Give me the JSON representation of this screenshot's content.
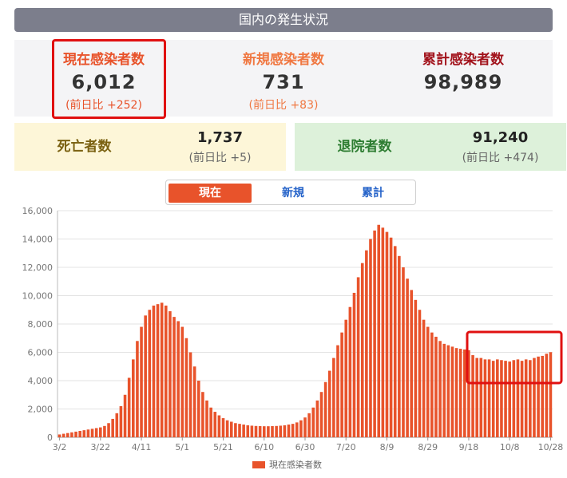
{
  "header": {
    "title": "国内の発生状況"
  },
  "stats": {
    "current": {
      "label": "現在感染者数",
      "value": "6,012",
      "diff": "(前日比 +252)"
    },
    "new": {
      "label": "新規感染者数",
      "value": "731",
      "diff": "(前日比 +83)"
    },
    "total": {
      "label": "累計感染者数",
      "value": "98,989"
    }
  },
  "deaths": {
    "label": "死亡者数",
    "value": "1,737",
    "diff": "(前日比 +5)"
  },
  "discharged": {
    "label": "退院者数",
    "value": "91,240",
    "diff": "(前日比 +474)"
  },
  "tabs": [
    "現在",
    "新規",
    "累計"
  ],
  "colors": {
    "bar": "#e8532b",
    "highlight": "#e01010"
  },
  "chart_data": {
    "type": "bar",
    "title": "",
    "xlabel": "",
    "ylabel": "",
    "ylim": [
      0,
      16000
    ],
    "yticks": [
      "0",
      "2,000",
      "4,000",
      "6,000",
      "8,000",
      "10,000",
      "12,000",
      "14,000",
      "16,000"
    ],
    "xticks": [
      "3/2",
      "3/22",
      "4/11",
      "5/1",
      "5/21",
      "6/10",
      "6/30",
      "7/20",
      "8/9",
      "8/29",
      "9/18",
      "10/8",
      "10/28"
    ],
    "grid": true,
    "legend": {
      "position": "bottom",
      "label": "現在感染者数"
    },
    "series": [
      {
        "name": "現在感染者数",
        "x": [
          "3/2",
          "3/4",
          "3/6",
          "3/8",
          "3/10",
          "3/12",
          "3/14",
          "3/16",
          "3/18",
          "3/20",
          "3/22",
          "3/24",
          "3/26",
          "3/28",
          "3/30",
          "4/1",
          "4/3",
          "4/5",
          "4/7",
          "4/9",
          "4/11",
          "4/13",
          "4/15",
          "4/17",
          "4/19",
          "4/21",
          "4/23",
          "4/25",
          "4/27",
          "4/29",
          "5/1",
          "5/3",
          "5/5",
          "5/7",
          "5/9",
          "5/11",
          "5/13",
          "5/15",
          "5/17",
          "5/19",
          "5/21",
          "5/23",
          "5/25",
          "5/27",
          "5/29",
          "5/31",
          "6/2",
          "6/4",
          "6/6",
          "6/8",
          "6/10",
          "6/12",
          "6/14",
          "6/16",
          "6/18",
          "6/20",
          "6/22",
          "6/24",
          "6/26",
          "6/28",
          "6/30",
          "7/2",
          "7/4",
          "7/6",
          "7/8",
          "7/10",
          "7/12",
          "7/14",
          "7/16",
          "7/18",
          "7/20",
          "7/22",
          "7/24",
          "7/26",
          "7/28",
          "7/30",
          "8/1",
          "8/3",
          "8/5",
          "8/7",
          "8/9",
          "8/11",
          "8/13",
          "8/15",
          "8/17",
          "8/19",
          "8/21",
          "8/23",
          "8/25",
          "8/27",
          "8/29",
          "8/31",
          "9/2",
          "9/4",
          "9/6",
          "9/8",
          "9/10",
          "9/12",
          "9/14",
          "9/16",
          "9/18",
          "9/20",
          "9/22",
          "9/24",
          "9/26",
          "9/28",
          "9/30",
          "10/2",
          "10/4",
          "10/6",
          "10/8",
          "10/10",
          "10/12",
          "10/14",
          "10/16",
          "10/18",
          "10/20",
          "10/22",
          "10/24",
          "10/26",
          "10/28"
        ],
        "values": [
          200,
          250,
          300,
          350,
          400,
          450,
          500,
          550,
          600,
          650,
          700,
          800,
          1000,
          1300,
          1700,
          2200,
          3000,
          4200,
          5500,
          6800,
          7800,
          8600,
          9000,
          9300,
          9400,
          9500,
          9300,
          8900,
          8500,
          8200,
          7800,
          7000,
          6000,
          5000,
          4000,
          3200,
          2600,
          2100,
          1800,
          1550,
          1350,
          1200,
          1100,
          1000,
          950,
          900,
          850,
          820,
          800,
          790,
          780,
          780,
          790,
          800,
          820,
          850,
          900,
          950,
          1050,
          1200,
          1400,
          1700,
          2100,
          2600,
          3200,
          3900,
          4700,
          5600,
          6500,
          7400,
          8300,
          9200,
          10200,
          11300,
          12300,
          13200,
          14000,
          14600,
          15000,
          14800,
          14500,
          14100,
          13500,
          12800,
          12000,
          11200,
          10400,
          9700,
          9000,
          8300,
          7800,
          7400,
          7100,
          6800,
          6600,
          6500,
          6400,
          6300,
          6250,
          6200,
          6150,
          5800,
          5600,
          5600,
          5500,
          5500,
          5400,
          5500,
          5450,
          5400,
          5350,
          5450,
          5500,
          5400,
          5500,
          5450,
          5600,
          5700,
          5750,
          5900,
          6012
        ]
      }
    ],
    "annotations": [
      "highlight-box-recent-period"
    ]
  }
}
